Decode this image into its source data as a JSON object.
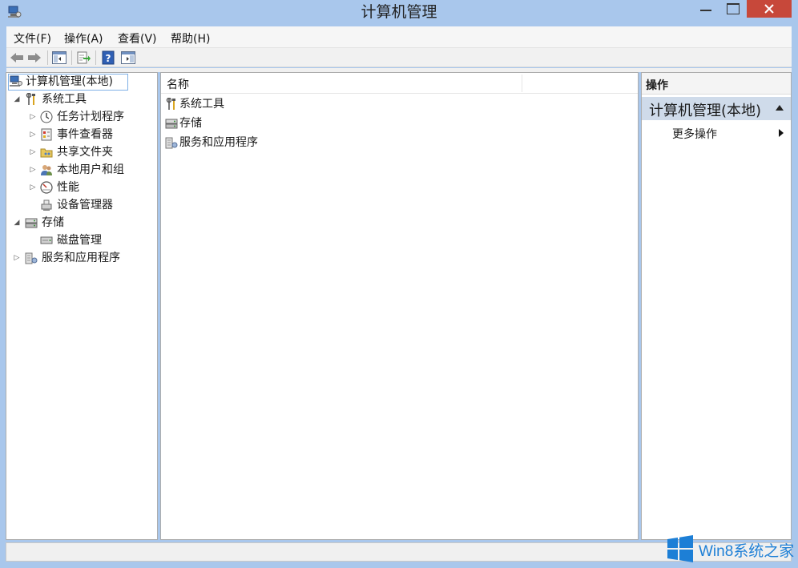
{
  "window": {
    "title": "计算机管理",
    "colors": {
      "frame": "#a9c7ec",
      "close_button": "#c7483a",
      "selection_border": "#7fb0e6",
      "action_group_bg": "#cfdbea",
      "watermark": "#1d7fd6"
    }
  },
  "menu": {
    "items": [
      "文件(F)",
      "操作(A)",
      "查看(V)",
      "帮助(H)"
    ]
  },
  "toolbar": {
    "buttons": [
      "back-arrow-icon",
      "forward-arrow-icon",
      "show-hide-console-tree-icon",
      "export-list-icon",
      "help-icon",
      "show-hide-action-pane-icon"
    ]
  },
  "tree": {
    "root": "计算机管理(本地)",
    "system_tools": "系统工具",
    "task_scheduler": "任务计划程序",
    "event_viewer": "事件查看器",
    "shared_folders": "共享文件夹",
    "local_users": "本地用户和组",
    "performance": "性能",
    "device_manager": "设备管理器",
    "storage": "存储",
    "disk_management": "磁盘管理",
    "services_apps": "服务和应用程序"
  },
  "list": {
    "column_name": "名称",
    "rows": [
      "系统工具",
      "存储",
      "服务和应用程序"
    ]
  },
  "actions": {
    "header": "操作",
    "group": "计算机管理(本地)",
    "more": "更多操作"
  },
  "watermark": {
    "text": "Win8系统之家"
  }
}
